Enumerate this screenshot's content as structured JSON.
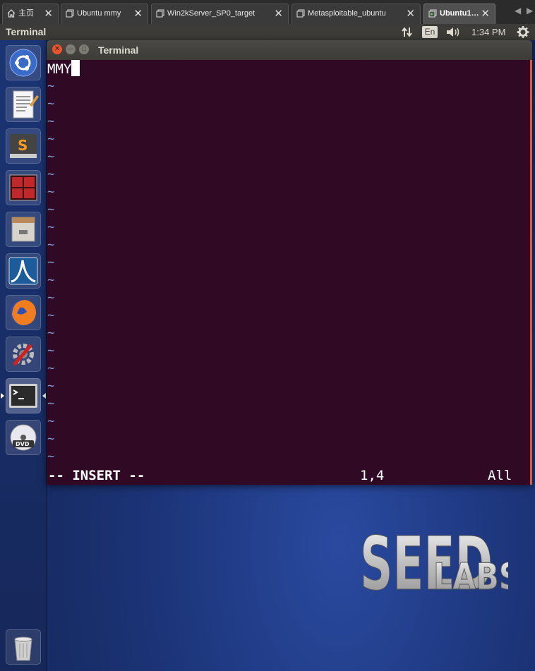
{
  "host_tabs": [
    {
      "label": "主页",
      "icon": "home-icon",
      "active": false
    },
    {
      "label": "Ubuntu mmy",
      "icon": "vm-icon",
      "active": false
    },
    {
      "label": "Win2kServer_SP0_target",
      "icon": "vm-icon",
      "active": false
    },
    {
      "label": "Metasploitable_ubuntu",
      "icon": "vm-icon",
      "active": false
    },
    {
      "label": "Ubuntu1…",
      "icon": "vm-running-icon",
      "active": true
    }
  ],
  "top_panel": {
    "app_title": "Terminal",
    "keyboard_layout": "En",
    "clock": "1:34 PM",
    "indicators": [
      "network-icon",
      "keyboard-icon",
      "volume-icon",
      "gear-icon"
    ]
  },
  "launcher": {
    "items": [
      "ubuntu-dash-icon",
      "text-editor-icon",
      "sublime-text-icon",
      "terminal-emulator-icon",
      "file-manager-icon",
      "wireshark-icon",
      "firefox-icon",
      "system-settings-icon",
      "terminal-icon",
      "dvd-icon"
    ],
    "trash": "trash-icon",
    "active_item": "terminal-icon"
  },
  "window": {
    "title": "Terminal",
    "buttons": [
      "close",
      "minimize",
      "maximize"
    ]
  },
  "editor": {
    "text": "MMY",
    "tilde_lines": 22,
    "mode": "-- INSERT --",
    "position": "1,4",
    "scroll": "All"
  },
  "wallpaper": {
    "logo_seed": "SEED",
    "logo_labs": "LABS"
  },
  "colors": {
    "terminal_bg": "#300a24",
    "tilde": "#7da0d8",
    "panel": "#3c3b37",
    "close_button": "#e9542f"
  }
}
